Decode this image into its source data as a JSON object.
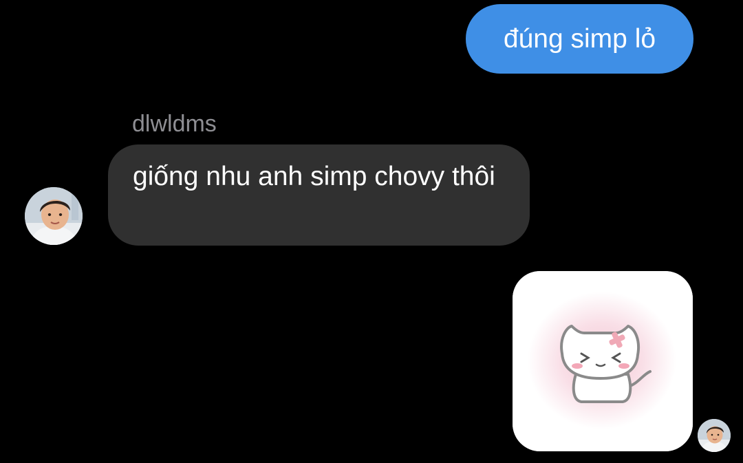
{
  "messages": {
    "outgoing_text": "đúng simp lỏ",
    "incoming_sender": "dlwldms",
    "incoming_text": "giống nhu anh simp chovy thôi"
  },
  "icons": {
    "incoming_avatar": "avatar-photo-child",
    "outgoing_avatar": "avatar-photo-child",
    "sticker": "crying-cat-sticker"
  },
  "colors": {
    "outgoing_bubble": "#3f8fe6",
    "incoming_bubble": "#303030",
    "background": "#000000",
    "sender_name": "#8e8e93"
  }
}
